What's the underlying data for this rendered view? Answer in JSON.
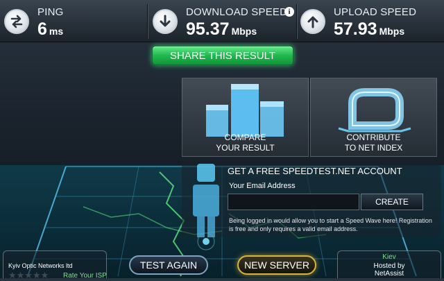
{
  "metrics": {
    "ping": {
      "label": "PING",
      "value": "6",
      "unit": "ms",
      "icon": "ping-arrows-icon"
    },
    "download": {
      "label": "DOWNLOAD SPEED",
      "value": "95.37",
      "unit": "Mbps",
      "icon": "arrow-down-icon",
      "info": "i"
    },
    "upload": {
      "label": "UPLOAD SPEED",
      "value": "57.93",
      "unit": "Mbps",
      "icon": "arrow-up-icon"
    }
  },
  "share": {
    "label": "SHARE THIS RESULT"
  },
  "panels": {
    "compare": {
      "line1": "COMPARE",
      "line2": "YOUR RESULT",
      "icon": "bar-chart-icon"
    },
    "contribute": {
      "line1": "CONTRIBUTE",
      "line2": "TO NET INDEX",
      "icon": "net-index-icon"
    }
  },
  "account": {
    "title": "GET A FREE SPEEDTEST.NET ACCOUNT",
    "email_label": "Your Email Address",
    "email_value": "",
    "create_label": "CREATE",
    "note": "Being logged in would allow you to start a Speed Wave here! Registration is free and only requires a valid email address."
  },
  "isp": {
    "name": "Kyiv Optic Networks ltd",
    "stars": "★★★★★",
    "rate_label": "Rate Your ISP"
  },
  "buttons": {
    "test_again": "TEST AGAIN",
    "new_server": "NEW SERVER"
  },
  "server": {
    "city": "Kiev",
    "hosted_line1": "Hosted by",
    "hosted_line2": "NetAssist"
  },
  "colors": {
    "share_green": "#22b84f",
    "new_server_gold": "#d8b63a",
    "accent_green": "#7fe08f",
    "cyan_glow": "#5cc8ff"
  }
}
